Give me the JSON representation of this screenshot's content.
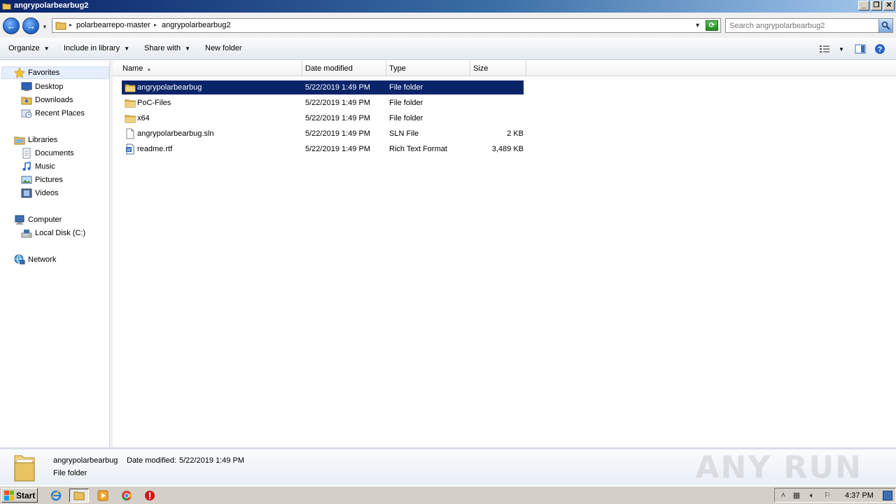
{
  "window": {
    "title": "angrypolarbearbug2",
    "buttons": [
      "minimize",
      "restore",
      "close"
    ]
  },
  "address": {
    "crumbs": [
      "polarbearrepo-master",
      "angrypolarbearbug2"
    ]
  },
  "search": {
    "placeholder": "Search angrypolarbearbug2"
  },
  "toolbar": {
    "organize": "Organize",
    "include_in_library": "Include in library",
    "share_with": "Share with",
    "new_folder": "New folder"
  },
  "nav": {
    "favorites": "Favorites",
    "desktop": "Desktop",
    "downloads": "Downloads",
    "recent_places": "Recent Places",
    "libraries": "Libraries",
    "documents": "Documents",
    "music": "Music",
    "pictures": "Pictures",
    "videos": "Videos",
    "computer": "Computer",
    "local_disk": "Local Disk (C:)",
    "network": "Network"
  },
  "columns": {
    "name": "Name",
    "date_modified": "Date modified",
    "type": "Type",
    "size": "Size"
  },
  "files": [
    {
      "name": "angrypolarbearbug",
      "date": "5/22/2019 1:49 PM",
      "type": "File folder",
      "size": "",
      "icon": "folder-icon",
      "selected": true
    },
    {
      "name": "PoC-Files",
      "date": "5/22/2019 1:49 PM",
      "type": "File folder",
      "size": "",
      "icon": "folder-icon",
      "selected": false
    },
    {
      "name": "x64",
      "date": "5/22/2019 1:49 PM",
      "type": "File folder",
      "size": "",
      "icon": "folder-icon",
      "selected": false
    },
    {
      "name": "angrypolarbearbug.sln",
      "date": "5/22/2019 1:49 PM",
      "type": "SLN File",
      "size": "2 KB",
      "icon": "file-icon",
      "selected": false
    },
    {
      "name": "readme.rtf",
      "date": "5/22/2019 1:49 PM",
      "type": "Rich Text Format",
      "size": "3,489 KB",
      "icon": "rtf-icon",
      "selected": false
    }
  ],
  "details": {
    "name": "angrypolarbearbug",
    "date_label": "Date modified:",
    "date_value": "5/22/2019 1:49 PM",
    "type": "File folder"
  },
  "watermark": "ANY RUN",
  "taskbar": {
    "start": "Start",
    "clock": "4:37 PM"
  },
  "colors": {
    "selection": "#0a246a",
    "folder": "#e8c15a"
  }
}
